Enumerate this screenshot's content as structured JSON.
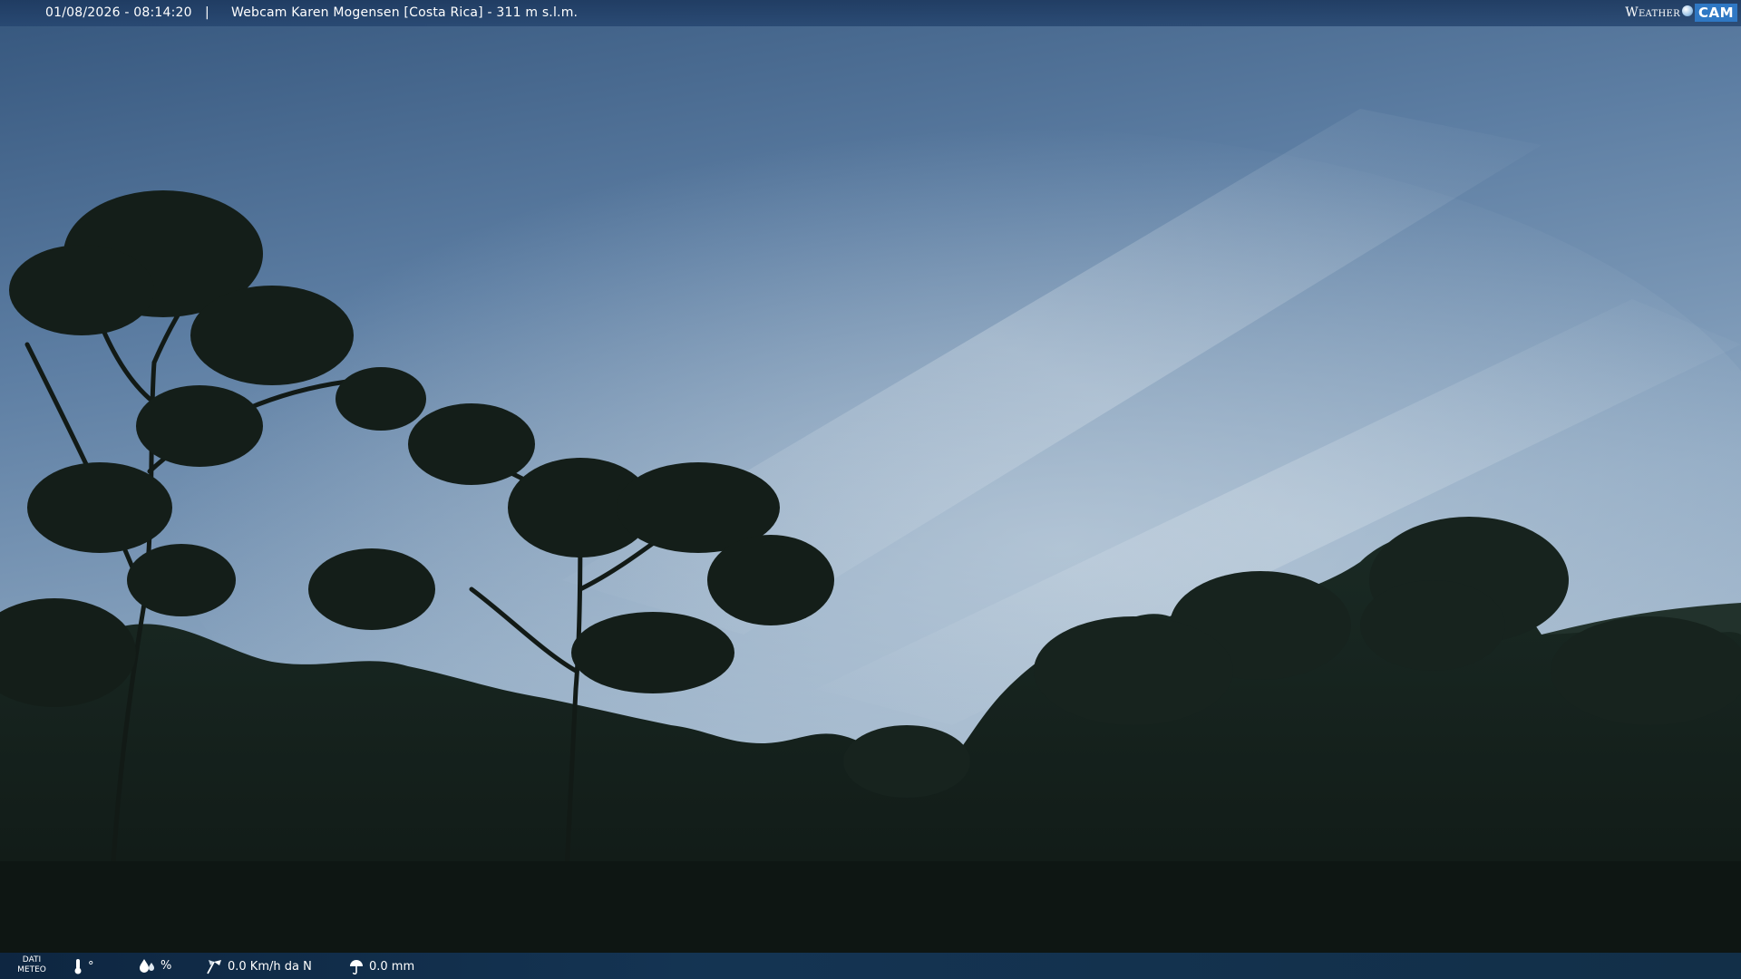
{
  "header": {
    "datetime": "01/08/2026 - 08:14:20",
    "separator": "|",
    "title": "Webcam Karen Mogensen [Costa Rica] - 311 m s.l.m."
  },
  "brand": {
    "weather": "Weather",
    "cam": "CAM"
  },
  "weather_bar": {
    "label_line1": "DATI",
    "label_line2": "METEO",
    "temperature_unit": "°",
    "humidity_unit": "%",
    "wind": "0.0 Km/h da N",
    "rain": "0.0 mm",
    "icons": [
      "thermometer-icon",
      "humidity-icon",
      "wind-icon",
      "rain-icon"
    ]
  },
  "colors": {
    "sky_top": "#3a5a80",
    "sky_light": "#a9bfd4",
    "foliage": "#141f1a",
    "bar": "#1e3a60"
  }
}
